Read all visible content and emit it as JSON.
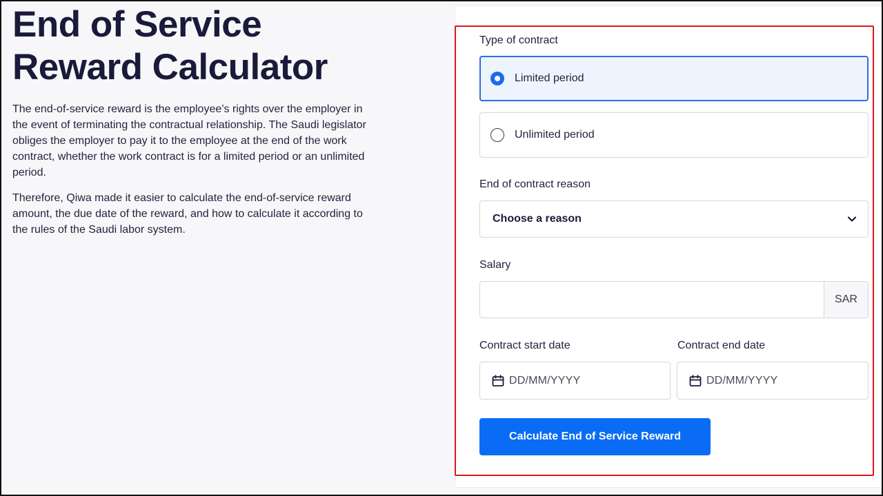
{
  "intro": {
    "title": "End of Service Reward Calculator",
    "paragraph_1": "The end-of-service reward is the employee’s rights over the employer in the event of terminating the contractual relationship. The Saudi legislator obliges the employer to pay it to the employee at the end of the work contract, whether the work contract is for a limited period or an unlimited period.",
    "paragraph_2": "Therefore, Qiwa made it easier to calculate the end-of-service reward amount, the due date of the reward, and how to calculate it according to the rules of the Saudi labor system."
  },
  "form": {
    "contract_type": {
      "label": "Type of contract",
      "options": [
        {
          "label": "Limited period",
          "selected": true
        },
        {
          "label": "Unlimited period",
          "selected": false
        }
      ]
    },
    "end_reason": {
      "label": "End of contract reason",
      "selected_value": "Choose a reason"
    },
    "salary": {
      "label": "Salary",
      "value": "",
      "unit": "SAR"
    },
    "start_date": {
      "label": "Contract start date",
      "placeholder": "DD/MM/YYYY"
    },
    "end_date": {
      "label": "Contract end date",
      "placeholder": "DD/MM/YYYY"
    },
    "submit_label": "Calculate End of Service Reward"
  },
  "colors": {
    "accent": "#0a6cf5",
    "selected_bg": "#eef4fd",
    "highlight_border": "#e0141a",
    "heading": "#1a1a3a"
  }
}
